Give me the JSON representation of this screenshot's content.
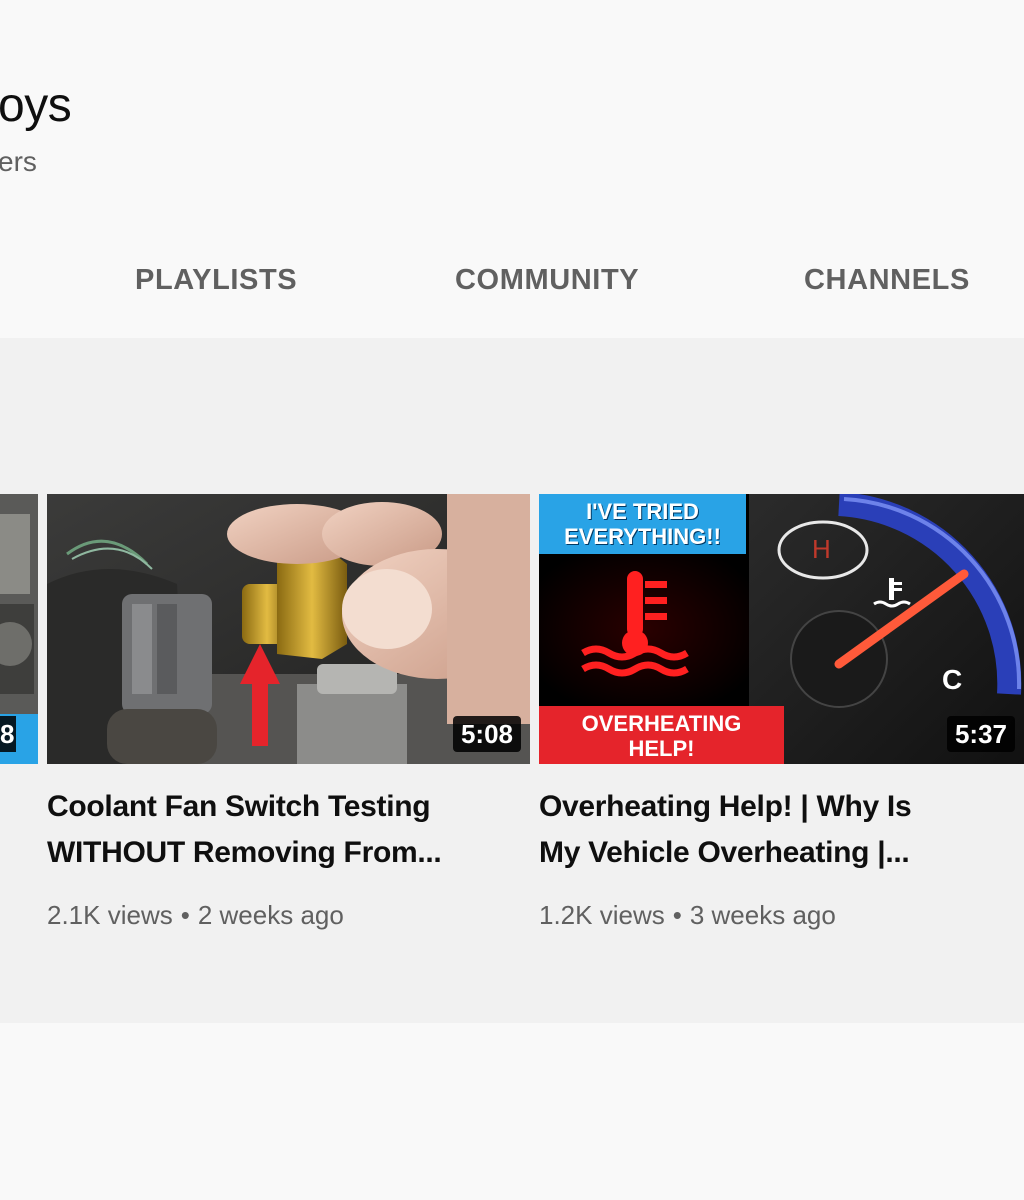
{
  "channel": {
    "name": "oys",
    "subscribers": "ers"
  },
  "tabs": [
    {
      "label": "PLAYLISTS"
    },
    {
      "label": "COMMUNITY"
    },
    {
      "label": "CHANNELS"
    }
  ],
  "videos": [
    {
      "duration": "8"
    },
    {
      "title_line1": "Coolant Fan Switch Testing",
      "title_line2": "WITHOUT Removing From...",
      "views": "2.1K views",
      "age": "2 weeks ago",
      "duration": "5:08"
    },
    {
      "title_line1": "Overheating Help! | Why Is",
      "title_line2": "My Vehicle Overheating |...",
      "views": "1.2K views",
      "age": "3 weeks ago",
      "duration": "5:37",
      "thumb_text_top_1": "I'VE TRIED",
      "thumb_text_top_2": "EVERYTHING!!",
      "thumb_text_bottom_1": "OVERHEATING",
      "thumb_text_bottom_2": "HELP!",
      "gauge_h": "H",
      "gauge_c": "C"
    }
  ],
  "colors": {
    "accent_blue": "#29a3e6",
    "warning_red": "#e5242b",
    "meta_gray": "#606060"
  }
}
